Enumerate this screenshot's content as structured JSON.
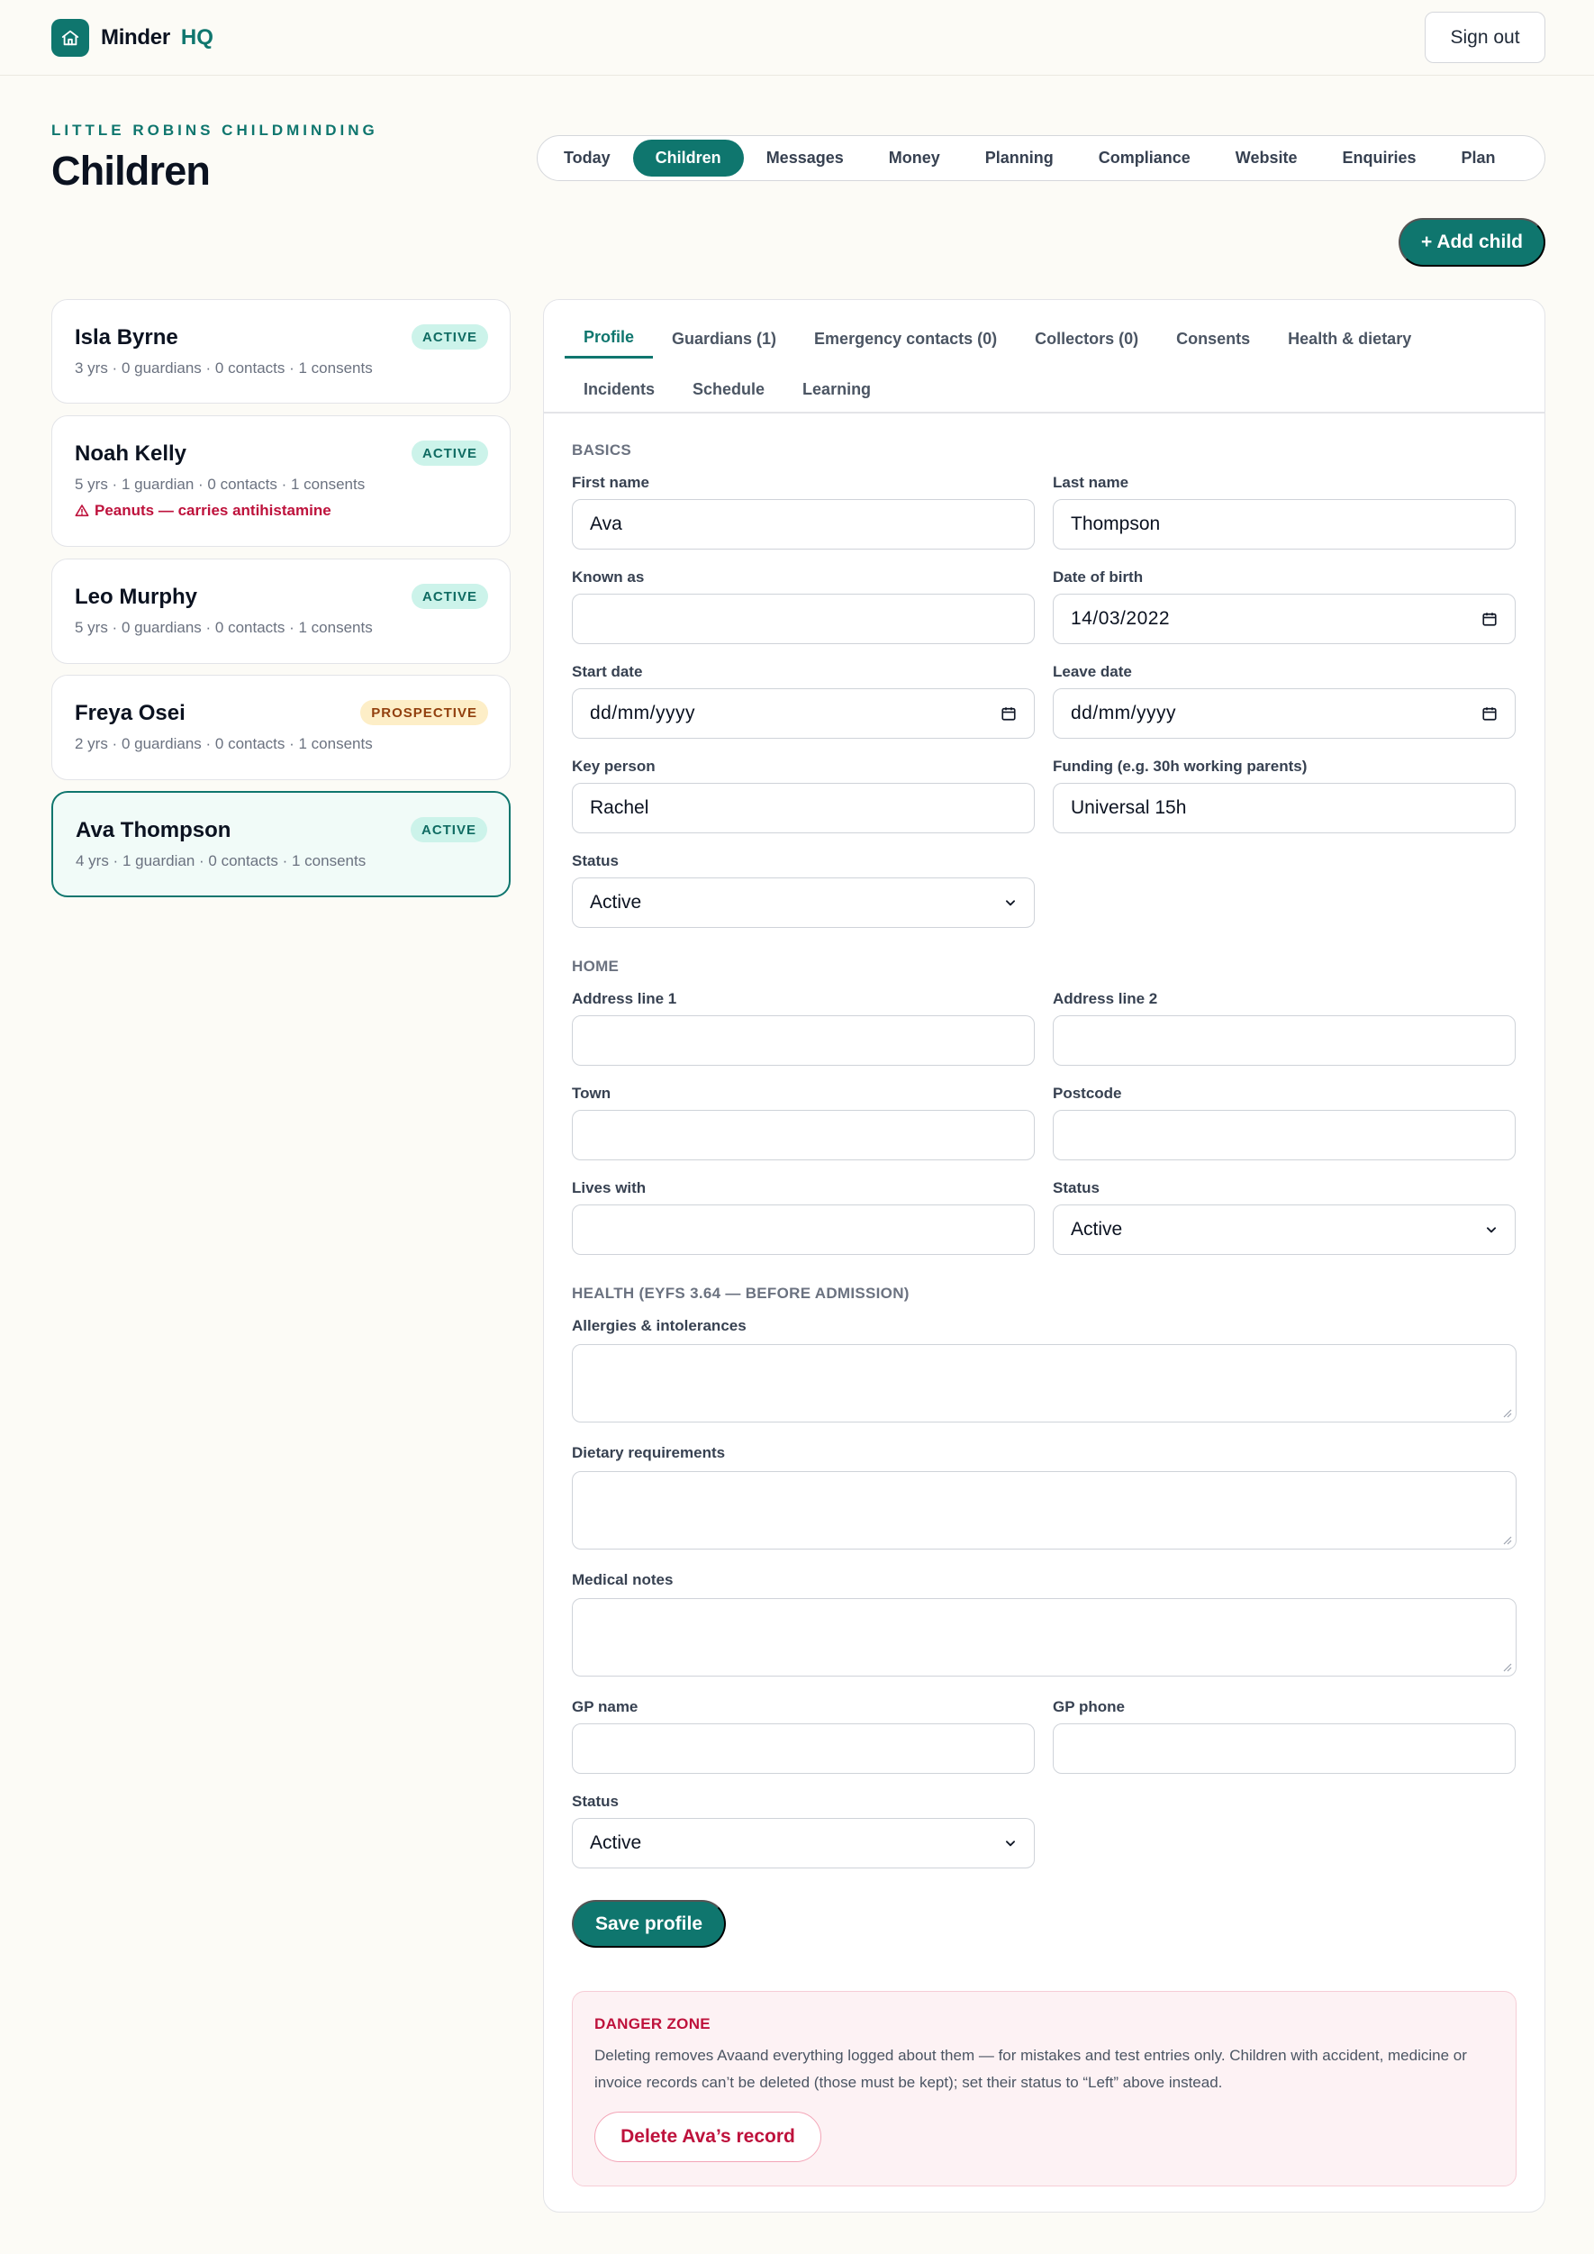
{
  "app": {
    "name": "Minder",
    "suffix": "HQ",
    "sign_out": "Sign out"
  },
  "page": {
    "org": "LITTLE ROBINS CHILDMINDING",
    "title": "Children",
    "add_child": "+ Add child"
  },
  "nav": {
    "tabs": [
      {
        "label": "Today",
        "active": false
      },
      {
        "label": "Children",
        "active": true
      },
      {
        "label": "Messages",
        "active": false
      },
      {
        "label": "Money",
        "active": false
      },
      {
        "label": "Planning",
        "active": false
      },
      {
        "label": "Compliance",
        "active": false
      },
      {
        "label": "Website",
        "active": false
      },
      {
        "label": "Enquiries",
        "active": false
      },
      {
        "label": "Plan",
        "active": false
      }
    ]
  },
  "children": [
    {
      "name": "Isla Byrne",
      "badge": "ACTIVE",
      "meta": "3 yrs · 0 guardians · 0 contacts · 1 consents",
      "alert": ""
    },
    {
      "name": "Noah Kelly",
      "badge": "ACTIVE",
      "meta": "5 yrs · 1 guardian · 0 contacts · 1 consents",
      "alert": "Peanuts — carries antihistamine"
    },
    {
      "name": "Leo Murphy",
      "badge": "ACTIVE",
      "meta": "5 yrs · 0 guardians · 0 contacts · 1 consents",
      "alert": ""
    },
    {
      "name": "Freya Osei",
      "badge": "PROSPECTIVE",
      "meta": "2 yrs · 0 guardians · 0 contacts · 1 consents",
      "alert": ""
    },
    {
      "name": "Ava Thompson",
      "badge": "ACTIVE",
      "meta": "4 yrs · 1 guardian · 0 contacts · 1 consents",
      "alert": ""
    }
  ],
  "detail": {
    "tabs": {
      "profile": "Profile",
      "guardians": "Guardians (1)",
      "emergency": "Emergency contacts (0)",
      "collectors": "Collectors (0)",
      "consents": "Consents",
      "health": "Health & dietary",
      "incidents": "Incidents",
      "schedule": "Schedule",
      "learning": "Learning"
    },
    "basics": {
      "heading": "BASICS",
      "first_name": {
        "label": "First name",
        "value": "Ava"
      },
      "last_name": {
        "label": "Last name",
        "value": "Thompson"
      },
      "known_as": {
        "label": "Known as",
        "value": ""
      },
      "dob": {
        "label": "Date of birth",
        "value": "14/03/2022"
      },
      "start_date": {
        "label": "Start date",
        "value": "dd/mm/yyyy"
      },
      "leave_date": {
        "label": "Leave date",
        "value": "dd/mm/yyyy"
      },
      "key_person": {
        "label": "Key person",
        "value": "Rachel"
      },
      "funding": {
        "label": "Funding (e.g. 30h working parents)",
        "value": "Universal 15h"
      },
      "status": {
        "label": "Status",
        "value": "Active"
      }
    },
    "home": {
      "heading": "HOME",
      "address1": {
        "label": "Address line 1",
        "value": ""
      },
      "address2": {
        "label": "Address line 2",
        "value": ""
      },
      "town": {
        "label": "Town",
        "value": ""
      },
      "postcode": {
        "label": "Postcode",
        "value": ""
      },
      "lives_with": {
        "label": "Lives with",
        "value": ""
      },
      "status": {
        "label": "Status",
        "value": "Active"
      }
    },
    "health": {
      "heading": "HEALTH (EYFS 3.64 — BEFORE ADMISSION)",
      "allergies": {
        "label": "Allergies & intolerances",
        "value": ""
      },
      "dietary": {
        "label": "Dietary requirements",
        "value": ""
      },
      "medical": {
        "label": "Medical notes",
        "value": ""
      },
      "gp_name": {
        "label": "GP name",
        "value": ""
      },
      "gp_phone": {
        "label": "GP phone",
        "value": ""
      },
      "status": {
        "label": "Status",
        "value": "Active"
      }
    },
    "save": "Save profile",
    "danger": {
      "title": "DANGER ZONE",
      "text": "Deleting removes Avaand everything logged about them — for mistakes and test entries only. Children with accident, medicine or invoice records can’t be deleted (those must be kept); set their status to “Left” above instead.",
      "button": "Delete Ava’s record"
    }
  },
  "colors": {
    "brand": "#0f766e",
    "danger": "#be123c",
    "background": "#fcfbf6"
  }
}
